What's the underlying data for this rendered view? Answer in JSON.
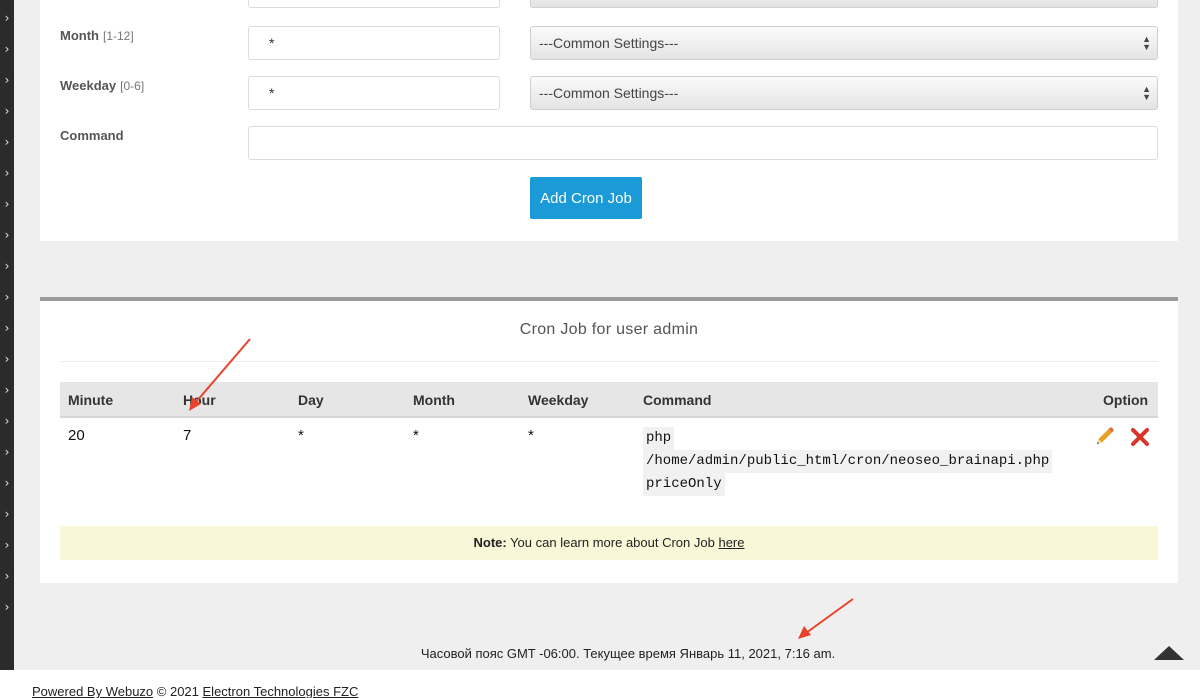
{
  "form": {
    "month": {
      "label": "Month",
      "range": "[1-12]",
      "value": "*",
      "select": "---Common Settings---"
    },
    "weekday": {
      "label": "Weekday",
      "range": "[0-6]",
      "value": "*",
      "select": "---Common Settings---"
    },
    "command": {
      "label": "Command",
      "value": ""
    },
    "add_button": "Add Cron Job"
  },
  "table": {
    "title": "Cron Job for user admin",
    "headers": {
      "minute": "Minute",
      "hour": "Hour",
      "day": "Day",
      "month": "Month",
      "weekday": "Weekday",
      "command": "Command",
      "option": "Option"
    },
    "rows": [
      {
        "minute": "20",
        "hour": "7",
        "day": "*",
        "month": "*",
        "weekday": "*",
        "command": [
          "php",
          "/home/admin/public_html/cron/neoseo_brainapi.php",
          "priceOnly"
        ]
      }
    ]
  },
  "note": {
    "prefix": "Note:",
    "text": " You can learn more about Cron Job ",
    "link": "here"
  },
  "timezone": "Часовой пояс GMT -06:00. Текущее время Январь 11, 2021, 7:16 am.",
  "footer": {
    "powered": "Powered By Webuzo",
    "copyright": " © 2021 ",
    "company": "Electron Technologies FZC"
  },
  "colors": {
    "accent": "#1a9ad6",
    "annotation_arrow": "#e8432b",
    "delete": "#d9342b",
    "edit": "#e8a125"
  },
  "icons": {
    "sidebar": "chevron-right-icon",
    "edit": "pencil-icon",
    "delete": "close-icon",
    "scroll": "triangle-up-icon"
  }
}
